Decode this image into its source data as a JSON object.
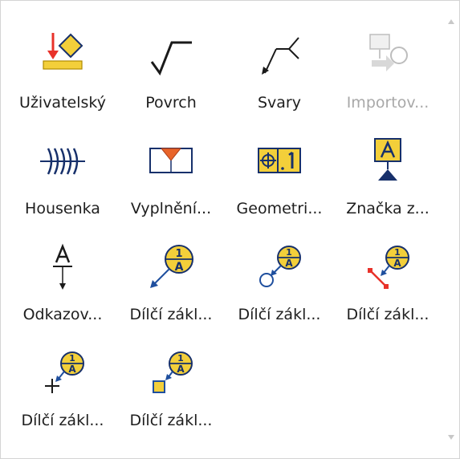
{
  "gallery": {
    "items": [
      {
        "label": "Uživatelský",
        "icon": "user-symbol-icon",
        "enabled": true
      },
      {
        "label": "Povrch",
        "icon": "surface-texture-icon",
        "enabled": true
      },
      {
        "label": "Svary",
        "icon": "weld-symbol-icon",
        "enabled": true
      },
      {
        "label": "Importov...",
        "icon": "import-symbol-icon",
        "enabled": false
      },
      {
        "label": "Housenka",
        "icon": "weld-bead-icon",
        "enabled": true
      },
      {
        "label": "Vyplnění...",
        "icon": "fill-weld-icon",
        "enabled": true
      },
      {
        "label": "Geometri...",
        "icon": "geometric-tolerance-icon",
        "enabled": true
      },
      {
        "label": "Značka z...",
        "icon": "datum-feature-icon",
        "enabled": true
      },
      {
        "label": "Odkazov...",
        "icon": "datum-reference-icon",
        "enabled": true
      },
      {
        "label": "Dílčí zákl...",
        "icon": "datum-target-arrow-icon",
        "enabled": true
      },
      {
        "label": "Dílčí zákl...",
        "icon": "datum-target-circle-icon",
        "enabled": true
      },
      {
        "label": "Dílčí zákl...",
        "icon": "datum-target-line-icon",
        "enabled": true
      },
      {
        "label": "Dílčí zákl...",
        "icon": "datum-target-point-icon",
        "enabled": true
      },
      {
        "label": "Dílčí zákl...",
        "icon": "datum-target-area-icon",
        "enabled": true
      }
    ]
  },
  "colors": {
    "yellow": "#f3cf3a",
    "red": "#e8322a",
    "navy": "#17306b",
    "blue": "#1f4f9e",
    "disabled_text": "#a8a8a8"
  }
}
